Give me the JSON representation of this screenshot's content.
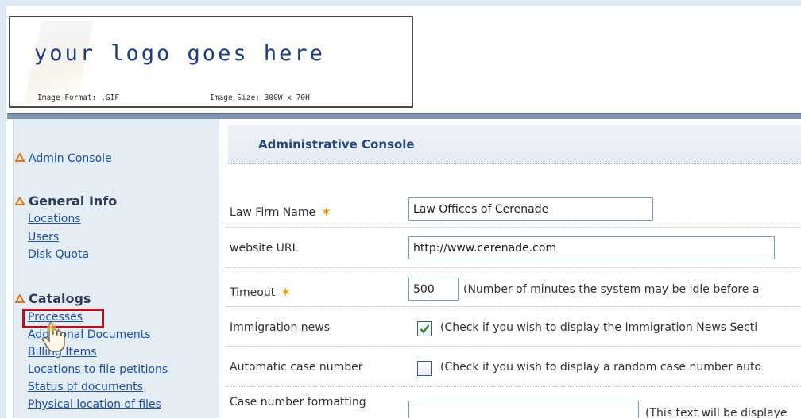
{
  "header": {
    "logo_text": "your logo goes here",
    "image_format": "Image Format: .GIF",
    "image_size": "Image Size: 300W x 70H"
  },
  "sidebar": {
    "admin_console": "Admin Console",
    "general_info": {
      "heading": "General Info",
      "items": [
        "Locations",
        "Users",
        "Disk Quota"
      ]
    },
    "catalogs": {
      "heading": "Catalogs",
      "items": [
        "Processes",
        "Additional Documents",
        "Billing Items",
        "Locations to file petitions",
        "Status of documents",
        "Physical location of files"
      ]
    }
  },
  "main": {
    "title": "Administrative Console",
    "fields": {
      "law_firm_name": {
        "label": "Law Firm Name",
        "value": "Law Offices of Cerenade",
        "required": true
      },
      "website_url": {
        "label": "website URL",
        "value": "http://www.cerenade.com"
      },
      "timeout": {
        "label": "Timeout",
        "value": "500",
        "required": true,
        "help": "(Number of minutes the system may be idle before a"
      },
      "immigration_news": {
        "label": "Immigration news",
        "checked": true,
        "help": "(Check if you wish to display the Immigration News Secti"
      },
      "automatic_case_number": {
        "label": "Automatic case number",
        "checked": false,
        "help": "(Check if you wish to display a random case number auto"
      },
      "case_number_formatting": {
        "label": "Case number formatting",
        "value": "",
        "help": "(This text will be displaye"
      }
    }
  },
  "colors": {
    "link": "#1f4fa6",
    "heading": "#264a7e",
    "required_star": "#f29a0c",
    "sidebar_bg": "#e4ecf4",
    "highlight": "#b3111a"
  }
}
